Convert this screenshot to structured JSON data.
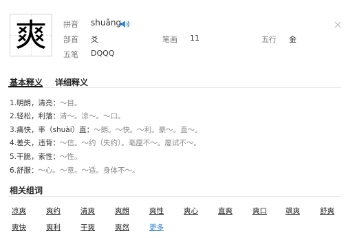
{
  "character": "爽",
  "info": {
    "pinyin_label": "拼音",
    "pinyin_value": "shuǎng",
    "radical_label": "部首",
    "radical_value": "爻",
    "strokes_label": "笔画",
    "strokes_value": "11",
    "wuxing_label": "五行",
    "wuxing_value": "金",
    "wubi_label": "五笔",
    "wubi_value": "DQQQ"
  },
  "tabs": [
    {
      "label": "基本释义"
    },
    {
      "label": "详细释义"
    }
  ],
  "definitions": [
    {
      "head": "1.明朗，清亮：",
      "examples": "～目。"
    },
    {
      "head": "2.轻松，利落：",
      "examples": "清～。凉～。～口。"
    },
    {
      "head": "3.痛快，率（shuài）直：",
      "examples": "～朗。～快。～利。豪～。直～。"
    },
    {
      "head": "4.差失，违背：",
      "examples": "～信。～约（失约）。毫厘不～。屡试不～。"
    },
    {
      "head": "5.干脆，索性：",
      "examples": "～性。"
    },
    {
      "head": "6.舒服：",
      "examples": "～心。～意。～适。身体不～。"
    }
  ],
  "related": {
    "title": "相关组词",
    "words": [
      "凉爽",
      "爽约",
      "清爽",
      "爽朗",
      "爽性",
      "爽心",
      "直爽",
      "爽口",
      "飒爽",
      "舒爽",
      "爽快",
      "爽利",
      "干爽",
      "爽然"
    ],
    "more_label": "更多"
  },
  "icons": {
    "speaker": "speaker-icon",
    "corner": "close-icon"
  },
  "colors": {
    "speaker_blue": "#2e86de",
    "more_link": "#2e7fd8"
  }
}
